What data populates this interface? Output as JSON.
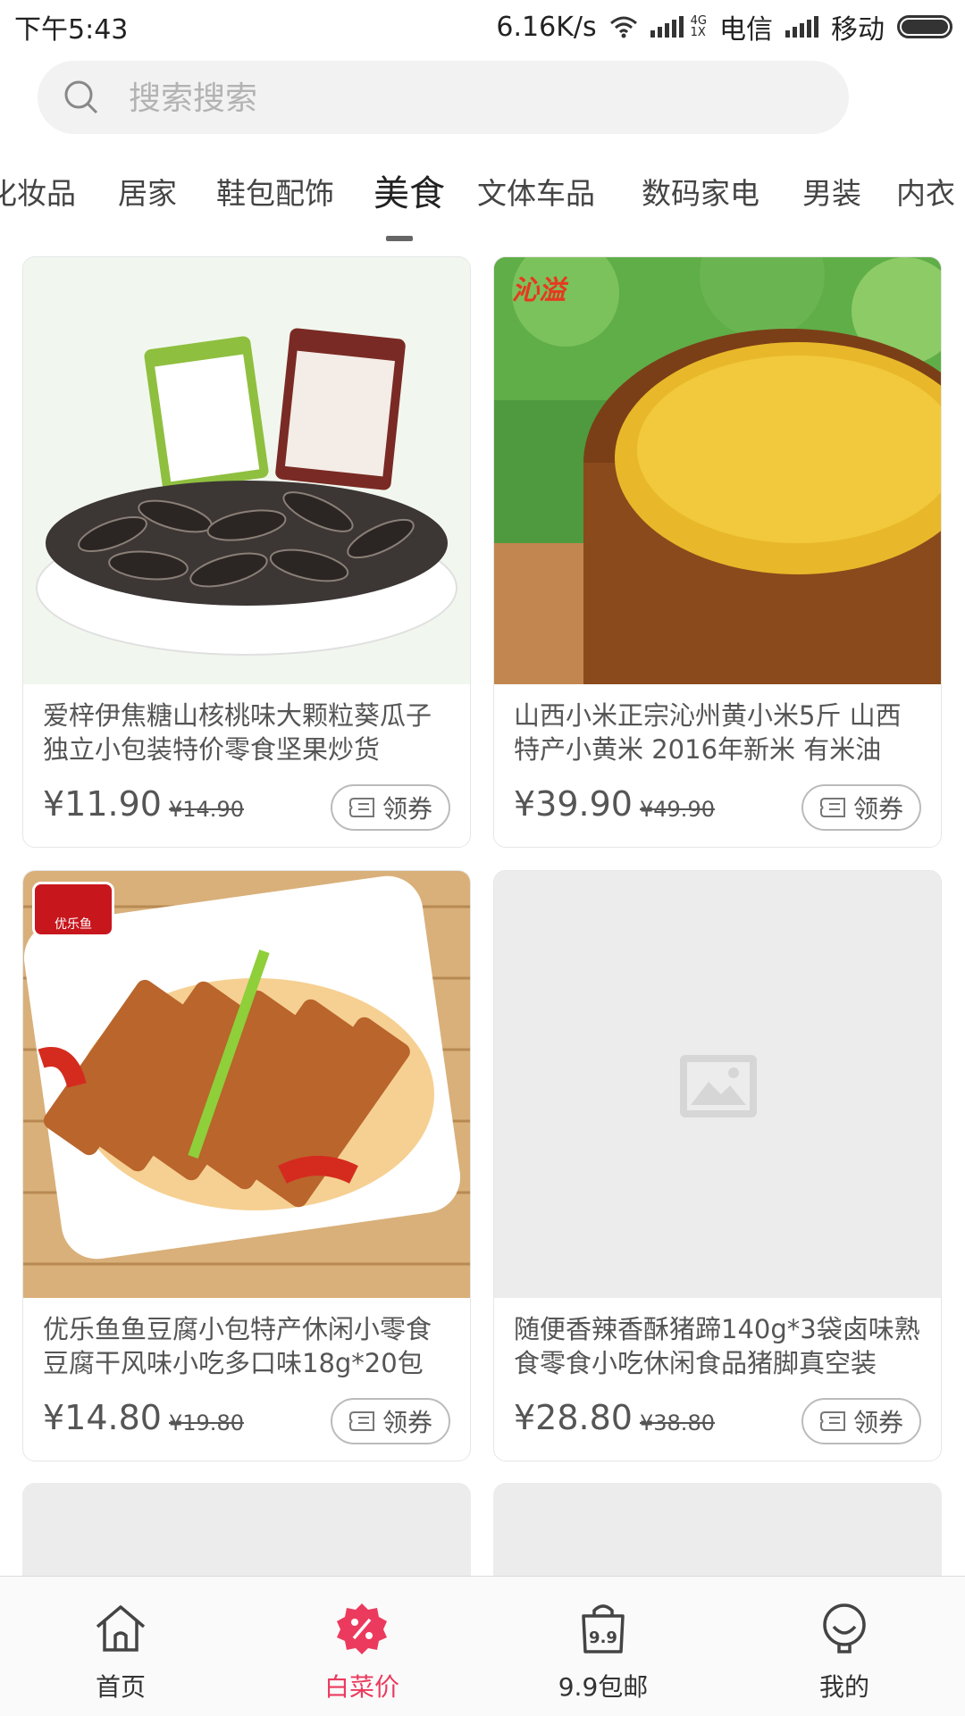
{
  "status_bar": {
    "time": "下午5:43",
    "net_speed": "6.16K/s",
    "net_type_top": "4G",
    "net_type_bottom": "1X",
    "carrier1": "电信",
    "carrier2": "移动"
  },
  "search": {
    "placeholder": "搜索搜索"
  },
  "tabs": [
    {
      "label": "化妆品"
    },
    {
      "label": "居家"
    },
    {
      "label": "鞋包配饰"
    },
    {
      "label": "美食",
      "active": true
    },
    {
      "label": "文体车品"
    },
    {
      "label": "数码家电"
    },
    {
      "label": "男装"
    },
    {
      "label": "内衣"
    }
  ],
  "products": [
    {
      "title": "爱梓伊焦糖山核桃味大颗粒葵瓜子独立小包装特价零食坚果炒货",
      "price": "¥11.90",
      "original_price": "¥14.90",
      "coupon": "领券",
      "image": "sunflower-seeds-image"
    },
    {
      "title": "山西小米正宗沁州黄小米5斤 山西特产小黄米 2016年新米 有米油",
      "price": "¥39.90",
      "original_price": "¥49.90",
      "coupon": "领券",
      "image": "millet-bowl-image",
      "brand_text": "沁溢"
    },
    {
      "title": "优乐鱼鱼豆腐小包特产休闲小零食豆腐干风味小吃多口味18g*20包",
      "price": "¥14.80",
      "original_price": "¥19.80",
      "coupon": "领券",
      "image": "fish-tofu-image",
      "brand_text": "优乐鱼"
    },
    {
      "title": "随便香辣香酥猪蹄140g*3袋卤味熟食零食小吃休闲食品猪脚真空装",
      "price": "¥28.80",
      "original_price": "¥38.80",
      "coupon": "领券",
      "image": "image-placeholder-icon"
    }
  ],
  "bottom_nav": [
    {
      "label": "首页",
      "icon": "home-icon"
    },
    {
      "label": "白菜价",
      "icon": "discount-icon",
      "active": true
    },
    {
      "label": "9.9包邮",
      "icon": "shopping-bag-icon"
    },
    {
      "label": "我的",
      "icon": "profile-icon"
    }
  ],
  "colors": {
    "accent": "#ec3a5e",
    "text": "#555555",
    "search_bg": "#f2f2f2"
  }
}
